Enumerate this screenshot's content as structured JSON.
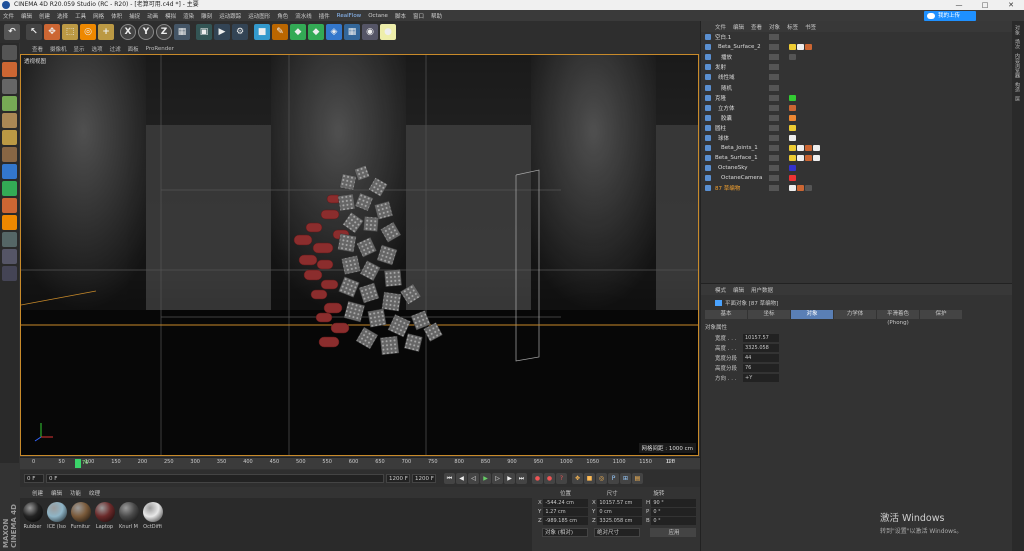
{
  "window": {
    "title": "CINEMA 4D R20.059 Studio (RC - R20) - [老算可用.c4d *] - 主要",
    "controls": [
      "—",
      "□",
      "✕"
    ]
  },
  "menubar": [
    "文件",
    "编辑",
    "创建",
    "选择",
    "工具",
    "网格",
    "体积",
    "捕捉",
    "动画",
    "模拟",
    "渲染",
    "雕刻",
    "运动跟踪",
    "运动图形",
    "角色",
    "流水线",
    "插件",
    "RealFlow",
    "Octane",
    "脚本",
    "窗口",
    "帮助"
  ],
  "cloud_button": "我的上传",
  "toolbar_icons": [
    "undo-icon",
    "select-icon",
    "move-icon",
    "scale-icon",
    "rotate-icon",
    "add-icon",
    "x-axis-icon",
    "y-axis-icon",
    "z-axis-icon",
    "coord-icon",
    "render-view-icon",
    "render-icon",
    "render-settings-icon",
    "cube-icon",
    "pen-icon",
    "subdivide-icon",
    "array-icon",
    "deformer-icon",
    "scene-icon",
    "camera-icon",
    "light-icon"
  ],
  "viewport_menu": [
    "查看",
    "摄像机",
    "显示",
    "选项",
    "过滤",
    "面板",
    "ProRender"
  ],
  "viewport": {
    "label": "透视视图",
    "grid_info": "网格间距 : 1000 cm"
  },
  "timeline": {
    "ticks": [
      "0",
      "50",
      "100",
      "150",
      "200",
      "250",
      "300",
      "350",
      "400",
      "450",
      "500",
      "550",
      "600",
      "650",
      "700",
      "750",
      "800",
      "850",
      "900",
      "950",
      "1000",
      "1050",
      "1100",
      "1150",
      "120"
    ],
    "current_frame": "76",
    "end_label": "0 F"
  },
  "timebar": {
    "start": "0 F",
    "min": "0 F",
    "max": "1200 F",
    "end": "1200 F"
  },
  "materials": {
    "tabs": [
      "创建",
      "编辑",
      "功能",
      "纹理"
    ],
    "items": [
      {
        "name": "Rubber",
        "color": "#222222"
      },
      {
        "name": "ICE (Iso",
        "color": "#8fb5c7"
      },
      {
        "name": "Furnitur",
        "color": "#7a5a3a"
      },
      {
        "name": "Laptop",
        "color": "#6b2a2a"
      },
      {
        "name": "Knurl M",
        "color": "#4a4a4a"
      },
      {
        "name": "OctDiffi",
        "color": "#e8e8e8"
      }
    ]
  },
  "coords": {
    "headers": [
      "位置",
      "尺寸",
      "旋转"
    ],
    "rows": [
      {
        "axis": "X",
        "pos": "-544.24 cm",
        "size_axis": "X",
        "size": "10157.57 cm",
        "rot_axis": "H",
        "rot": "90 °"
      },
      {
        "axis": "Y",
        "pos": "1.27 cm",
        "size_axis": "Y",
        "size": "0 cm",
        "rot_axis": "P",
        "rot": "0 °"
      },
      {
        "axis": "Z",
        "pos": "-989.185 cm",
        "size_axis": "Z",
        "size": "3325.058 cm",
        "rot_axis": "B",
        "rot": "0 °"
      }
    ],
    "mode": "对象 (相对)",
    "size_mode": "绝对尺寸",
    "apply": "应用"
  },
  "object_manager": {
    "menu": [
      "文件",
      "编辑",
      "查看",
      "对象",
      "标签",
      "书签"
    ],
    "objects": [
      {
        "name": "空白.1",
        "gold": false
      },
      {
        "name": "Beta_Surface_2",
        "gold": false
      },
      {
        "name": "播放",
        "gold": false
      },
      {
        "name": "发射",
        "gold": false
      },
      {
        "name": "线性域",
        "gold": false
      },
      {
        "name": "随机",
        "gold": false
      },
      {
        "name": "克隆",
        "gold": false
      },
      {
        "name": "立方体",
        "gold": false
      },
      {
        "name": "胶囊",
        "gold": false
      },
      {
        "name": "圆柱",
        "gold": false
      },
      {
        "name": "球体",
        "gold": false
      },
      {
        "name": "Beta_Joints_1",
        "gold": false
      },
      {
        "name": "Beta_Surface_1",
        "gold": false
      },
      {
        "name": "OctaneSky",
        "gold": false
      },
      {
        "name": "OctaneCamera",
        "gold": false
      },
      {
        "name": "87 草编物",
        "gold": true
      }
    ]
  },
  "attribute_manager": {
    "menu": [
      "模式",
      "编辑",
      "用户数据"
    ],
    "title": "平面对象 [87 草编物]",
    "tabs": [
      "基本",
      "坐标",
      "对象",
      "力学体",
      "平滑着色(Phong)",
      "保护"
    ],
    "active_tab": "对象",
    "section": "对象属性",
    "props": [
      {
        "label": "宽度 . . .",
        "value": "10157.57"
      },
      {
        "label": "高度 . . .",
        "value": "3325.058"
      },
      {
        "label": "宽度分段",
        "value": "44"
      },
      {
        "label": "高度分段",
        "value": "76"
      },
      {
        "label": "方向 . . .",
        "value": "+Y"
      }
    ]
  },
  "right_strip": [
    "对象",
    "场次",
    "内容浏览器",
    "构造",
    "层"
  ],
  "activate": {
    "title": "激活 Windows",
    "subtitle": "转到\"设置\"以激活 Windows。"
  },
  "brand": "MAXON CINEMA 4D"
}
